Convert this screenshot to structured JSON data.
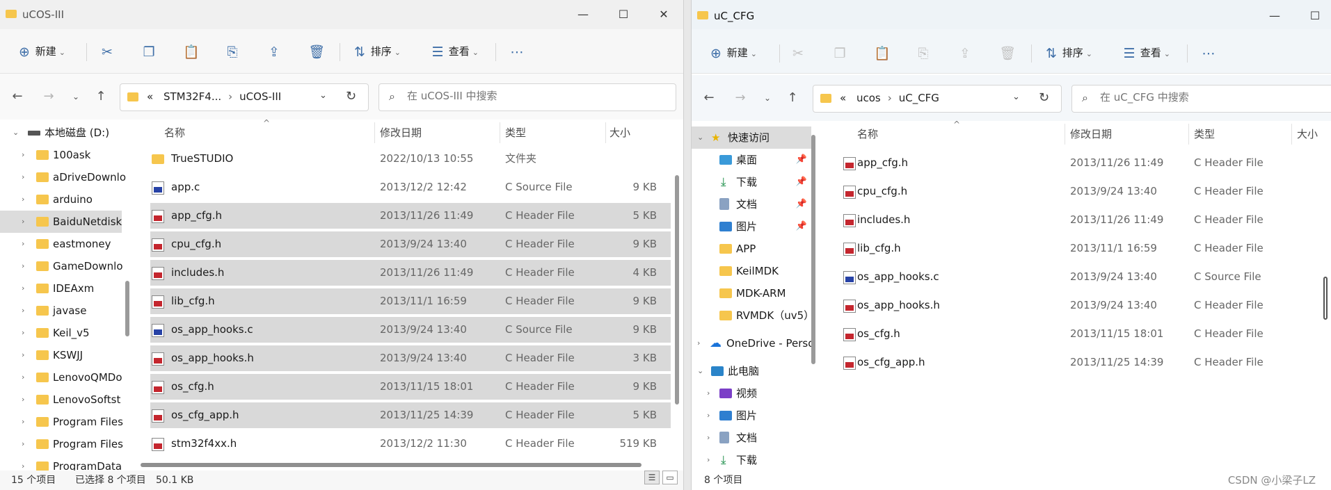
{
  "left": {
    "title": "uCOS-III",
    "toolbar": {
      "new": "新建",
      "sort": "排序",
      "view": "查看"
    },
    "address": {
      "prefix": "«",
      "seg1": "STM32F4...",
      "seg2": "uCOS-III"
    },
    "search": {
      "placeholder": "在 uCOS-III 中搜索"
    },
    "nav": [
      {
        "label": "本地磁盘 (D:)"
      },
      {
        "label": "100ask"
      },
      {
        "label": "aDriveDownlo"
      },
      {
        "label": "arduino"
      },
      {
        "label": "BaiduNetdisk"
      },
      {
        "label": "eastmoney"
      },
      {
        "label": "GameDownlo"
      },
      {
        "label": "IDEAxm"
      },
      {
        "label": "javase"
      },
      {
        "label": "Keil_v5"
      },
      {
        "label": "KSWJJ"
      },
      {
        "label": "LenovoQMDo"
      },
      {
        "label": "LenovoSoftst"
      },
      {
        "label": "Program Files"
      },
      {
        "label": "Program Files"
      },
      {
        "label": "ProgramData"
      }
    ],
    "columns": {
      "name": "名称",
      "date": "修改日期",
      "type": "类型",
      "size": "大小"
    },
    "files": [
      {
        "name": "TrueSTUDIO",
        "date": "2022/10/13 10:55",
        "type": "文件夹",
        "size": ""
      },
      {
        "name": "app.c",
        "date": "2013/12/2 12:42",
        "type": "C Source File",
        "size": "9 KB"
      },
      {
        "name": "app_cfg.h",
        "date": "2013/11/26 11:49",
        "type": "C Header File",
        "size": "5 KB"
      },
      {
        "name": "cpu_cfg.h",
        "date": "2013/9/24 13:40",
        "type": "C Header File",
        "size": "9 KB"
      },
      {
        "name": "includes.h",
        "date": "2013/11/26 11:49",
        "type": "C Header File",
        "size": "4 KB"
      },
      {
        "name": "lib_cfg.h",
        "date": "2013/11/1 16:59",
        "type": "C Header File",
        "size": "9 KB"
      },
      {
        "name": "os_app_hooks.c",
        "date": "2013/9/24 13:40",
        "type": "C Source File",
        "size": "9 KB"
      },
      {
        "name": "os_app_hooks.h",
        "date": "2013/9/24 13:40",
        "type": "C Header File",
        "size": "3 KB"
      },
      {
        "name": "os_cfg.h",
        "date": "2013/11/15 18:01",
        "type": "C Header File",
        "size": "9 KB"
      },
      {
        "name": "os_cfg_app.h",
        "date": "2013/11/25 14:39",
        "type": "C Header File",
        "size": "5 KB"
      },
      {
        "name": "stm32f4xx.h",
        "date": "2013/12/2 11:30",
        "type": "C Header File",
        "size": "519 KB"
      }
    ],
    "status": {
      "count": "15 个项目",
      "selected": "已选择 8 个项目",
      "size": "50.1 KB"
    }
  },
  "right": {
    "title": "uC_CFG",
    "toolbar": {
      "new": "新建",
      "sort": "排序",
      "view": "查看"
    },
    "address": {
      "prefix": "«",
      "seg1": "ucos",
      "seg2": "uC_CFG"
    },
    "search": {
      "placeholder": "在 uC_CFG 中搜索"
    },
    "nav": [
      {
        "label": "快速访问"
      },
      {
        "label": "桌面"
      },
      {
        "label": "下载"
      },
      {
        "label": "文档"
      },
      {
        "label": "图片"
      },
      {
        "label": "APP"
      },
      {
        "label": "KeilMDK"
      },
      {
        "label": "MDK-ARM"
      },
      {
        "label": "RVMDK（uv5）"
      },
      {
        "label": "OneDrive - Perso"
      },
      {
        "label": "此电脑"
      },
      {
        "label": "视频"
      },
      {
        "label": "图片"
      },
      {
        "label": "文档"
      },
      {
        "label": "下载"
      }
    ],
    "columns": {
      "name": "名称",
      "date": "修改日期",
      "type": "类型",
      "size": "大小"
    },
    "files": [
      {
        "name": "app_cfg.h",
        "date": "2013/11/26 11:49",
        "type": "C Header File"
      },
      {
        "name": "cpu_cfg.h",
        "date": "2013/9/24 13:40",
        "type": "C Header File"
      },
      {
        "name": "includes.h",
        "date": "2013/11/26 11:49",
        "type": "C Header File"
      },
      {
        "name": "lib_cfg.h",
        "date": "2013/11/1 16:59",
        "type": "C Header File"
      },
      {
        "name": "os_app_hooks.c",
        "date": "2013/9/24 13:40",
        "type": "C Source File"
      },
      {
        "name": "os_app_hooks.h",
        "date": "2013/9/24 13:40",
        "type": "C Header File"
      },
      {
        "name": "os_cfg.h",
        "date": "2013/11/15 18:01",
        "type": "C Header File"
      },
      {
        "name": "os_cfg_app.h",
        "date": "2013/11/25 14:39",
        "type": "C Header File"
      }
    ],
    "status": {
      "count": "8 个项目"
    }
  },
  "watermark": "CSDN @小梁子LZ"
}
